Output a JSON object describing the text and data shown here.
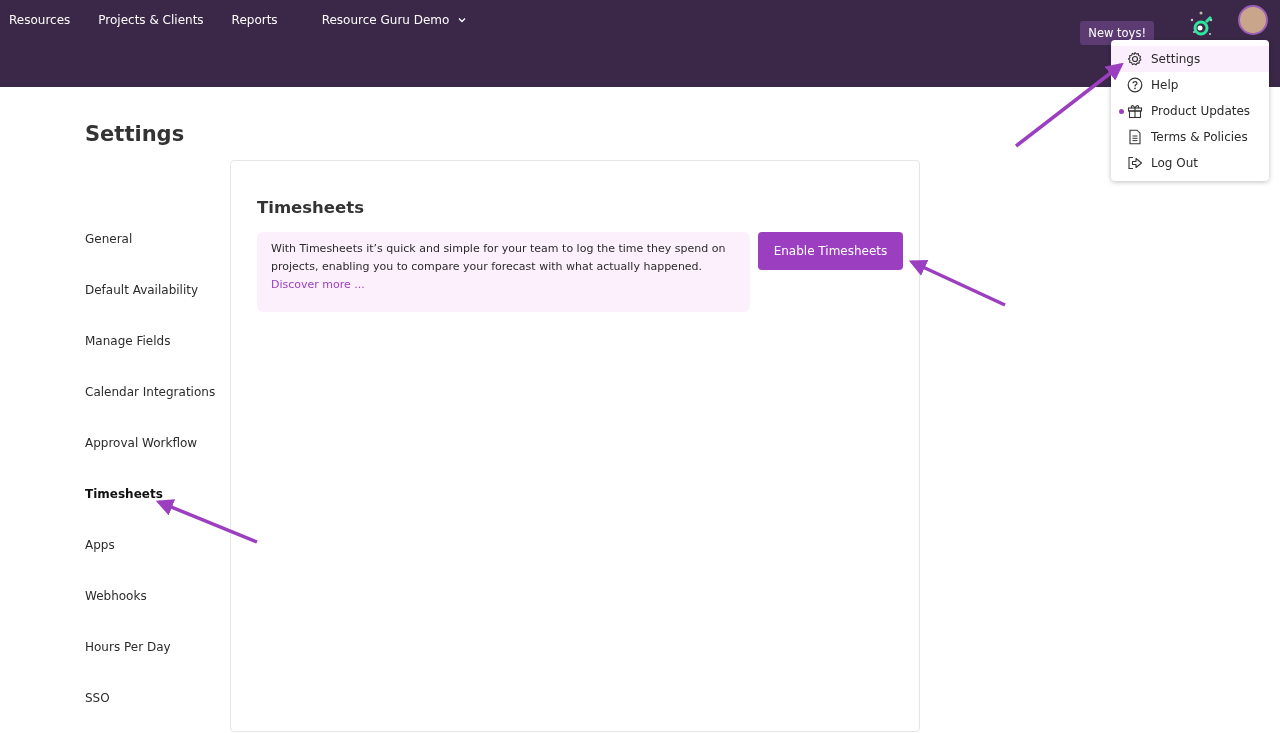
{
  "nav": [
    {
      "label": "Resources",
      "kind": "link"
    },
    {
      "label": "Projects & Clients",
      "kind": "link"
    },
    {
      "label": "Reports",
      "kind": "link"
    },
    {
      "label": "Resource Guru Demo",
      "kind": "dropdown"
    }
  ],
  "tooltip": "New toys!",
  "user_menu": [
    {
      "label": "Settings",
      "kind": "gear",
      "selected": true,
      "unread": false
    },
    {
      "label": "Help",
      "kind": "help",
      "selected": false,
      "unread": false
    },
    {
      "label": "Product Updates",
      "kind": "gift",
      "selected": false,
      "unread": true
    },
    {
      "label": "Terms & Policies",
      "kind": "document",
      "selected": false,
      "unread": false
    },
    {
      "label": "Log Out",
      "kind": "logout",
      "selected": false,
      "unread": false
    }
  ],
  "page_title": "Settings",
  "sidebar": [
    {
      "label": "General",
      "selected": false
    },
    {
      "label": "Default Availability",
      "selected": false
    },
    {
      "label": "Manage Fields",
      "selected": false
    },
    {
      "label": "Calendar Integrations",
      "selected": false
    },
    {
      "label": "Approval Workflow",
      "selected": false
    },
    {
      "label": "Timesheets",
      "selected": true
    },
    {
      "label": "Apps",
      "selected": false
    },
    {
      "label": "Webhooks",
      "selected": false
    },
    {
      "label": "Hours Per Day",
      "selected": false
    },
    {
      "label": "SSO",
      "selected": false
    }
  ],
  "panel": {
    "title": "Timesheets",
    "info": "With Timesheets it’s quick and simple for your team to log the time they spend on projects, enabling you to compare your forecast with what actually happened.",
    "link": "Discover more ...",
    "button": "Enable Timesheets"
  }
}
